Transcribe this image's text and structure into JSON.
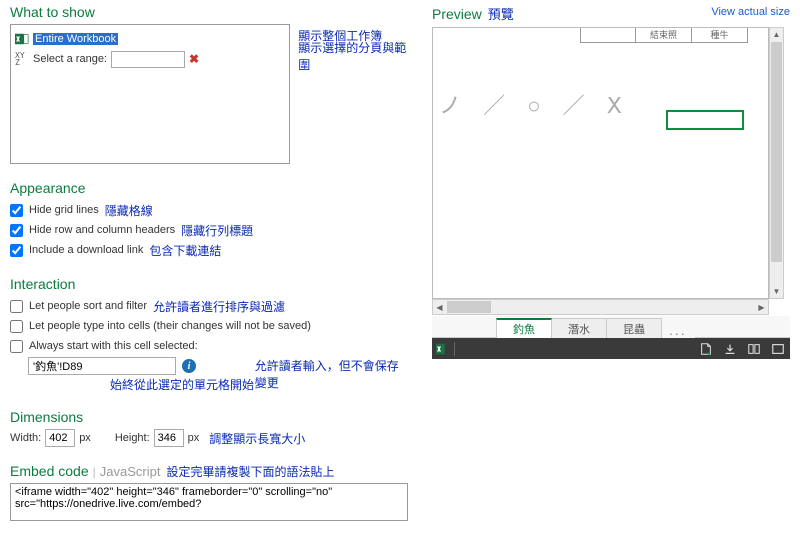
{
  "what_to_show": {
    "header": "What to show",
    "entire_workbook": "Entire Workbook",
    "annot_entire": "顯示整個工作簿",
    "select_range_label": "Select a range:",
    "range_value": "",
    "annot_range": "顯示選擇的分頁與範圍"
  },
  "appearance": {
    "header": "Appearance",
    "hide_grid": "Hide grid lines",
    "annot_grid": "隱藏格線",
    "hide_headers": "Hide row and column headers",
    "annot_headers": "隱藏行列標題",
    "include_dl": "Include a download link",
    "annot_dl": "包含下載連結"
  },
  "interaction": {
    "header": "Interaction",
    "sort_filter": "Let people sort and filter",
    "annot_sort": "允許讀者進行排序與過濾",
    "type_cells": "Let people type into cells (their changes will not be saved)",
    "annot_type": "允許讀者輸入，但不會保存變更",
    "always_start": "Always start with this cell selected:",
    "start_cell_value": "'釣魚'!D89",
    "annot_start": "始終從此選定的單元格開始"
  },
  "dimensions": {
    "header": "Dimensions",
    "width_label": "Width:",
    "width_value": "402",
    "px": "px",
    "height_label": "Height:",
    "height_value": "346",
    "annot": "調整顯示長寬大小"
  },
  "embed": {
    "header": "Embed code",
    "js_label": "JavaScript",
    "annot": "設定完畢請複製下面的語法貼上",
    "code": "<iframe width=\"402\" height=\"346\" frameborder=\"0\" scrolling=\"no\" src=\"https://onedrive.live.com/embed?"
  },
  "preview": {
    "header": "Preview",
    "cn": "預覽",
    "view_actual": "View actual size",
    "faint_text": "ノ ／ ○ ／ Ⅹ",
    "header_cells": [
      "",
      "結束照",
      "種牛"
    ],
    "tabs": [
      "釣魚",
      "潛水",
      "昆蟲"
    ],
    "active_tab": 0,
    "more": "..."
  }
}
